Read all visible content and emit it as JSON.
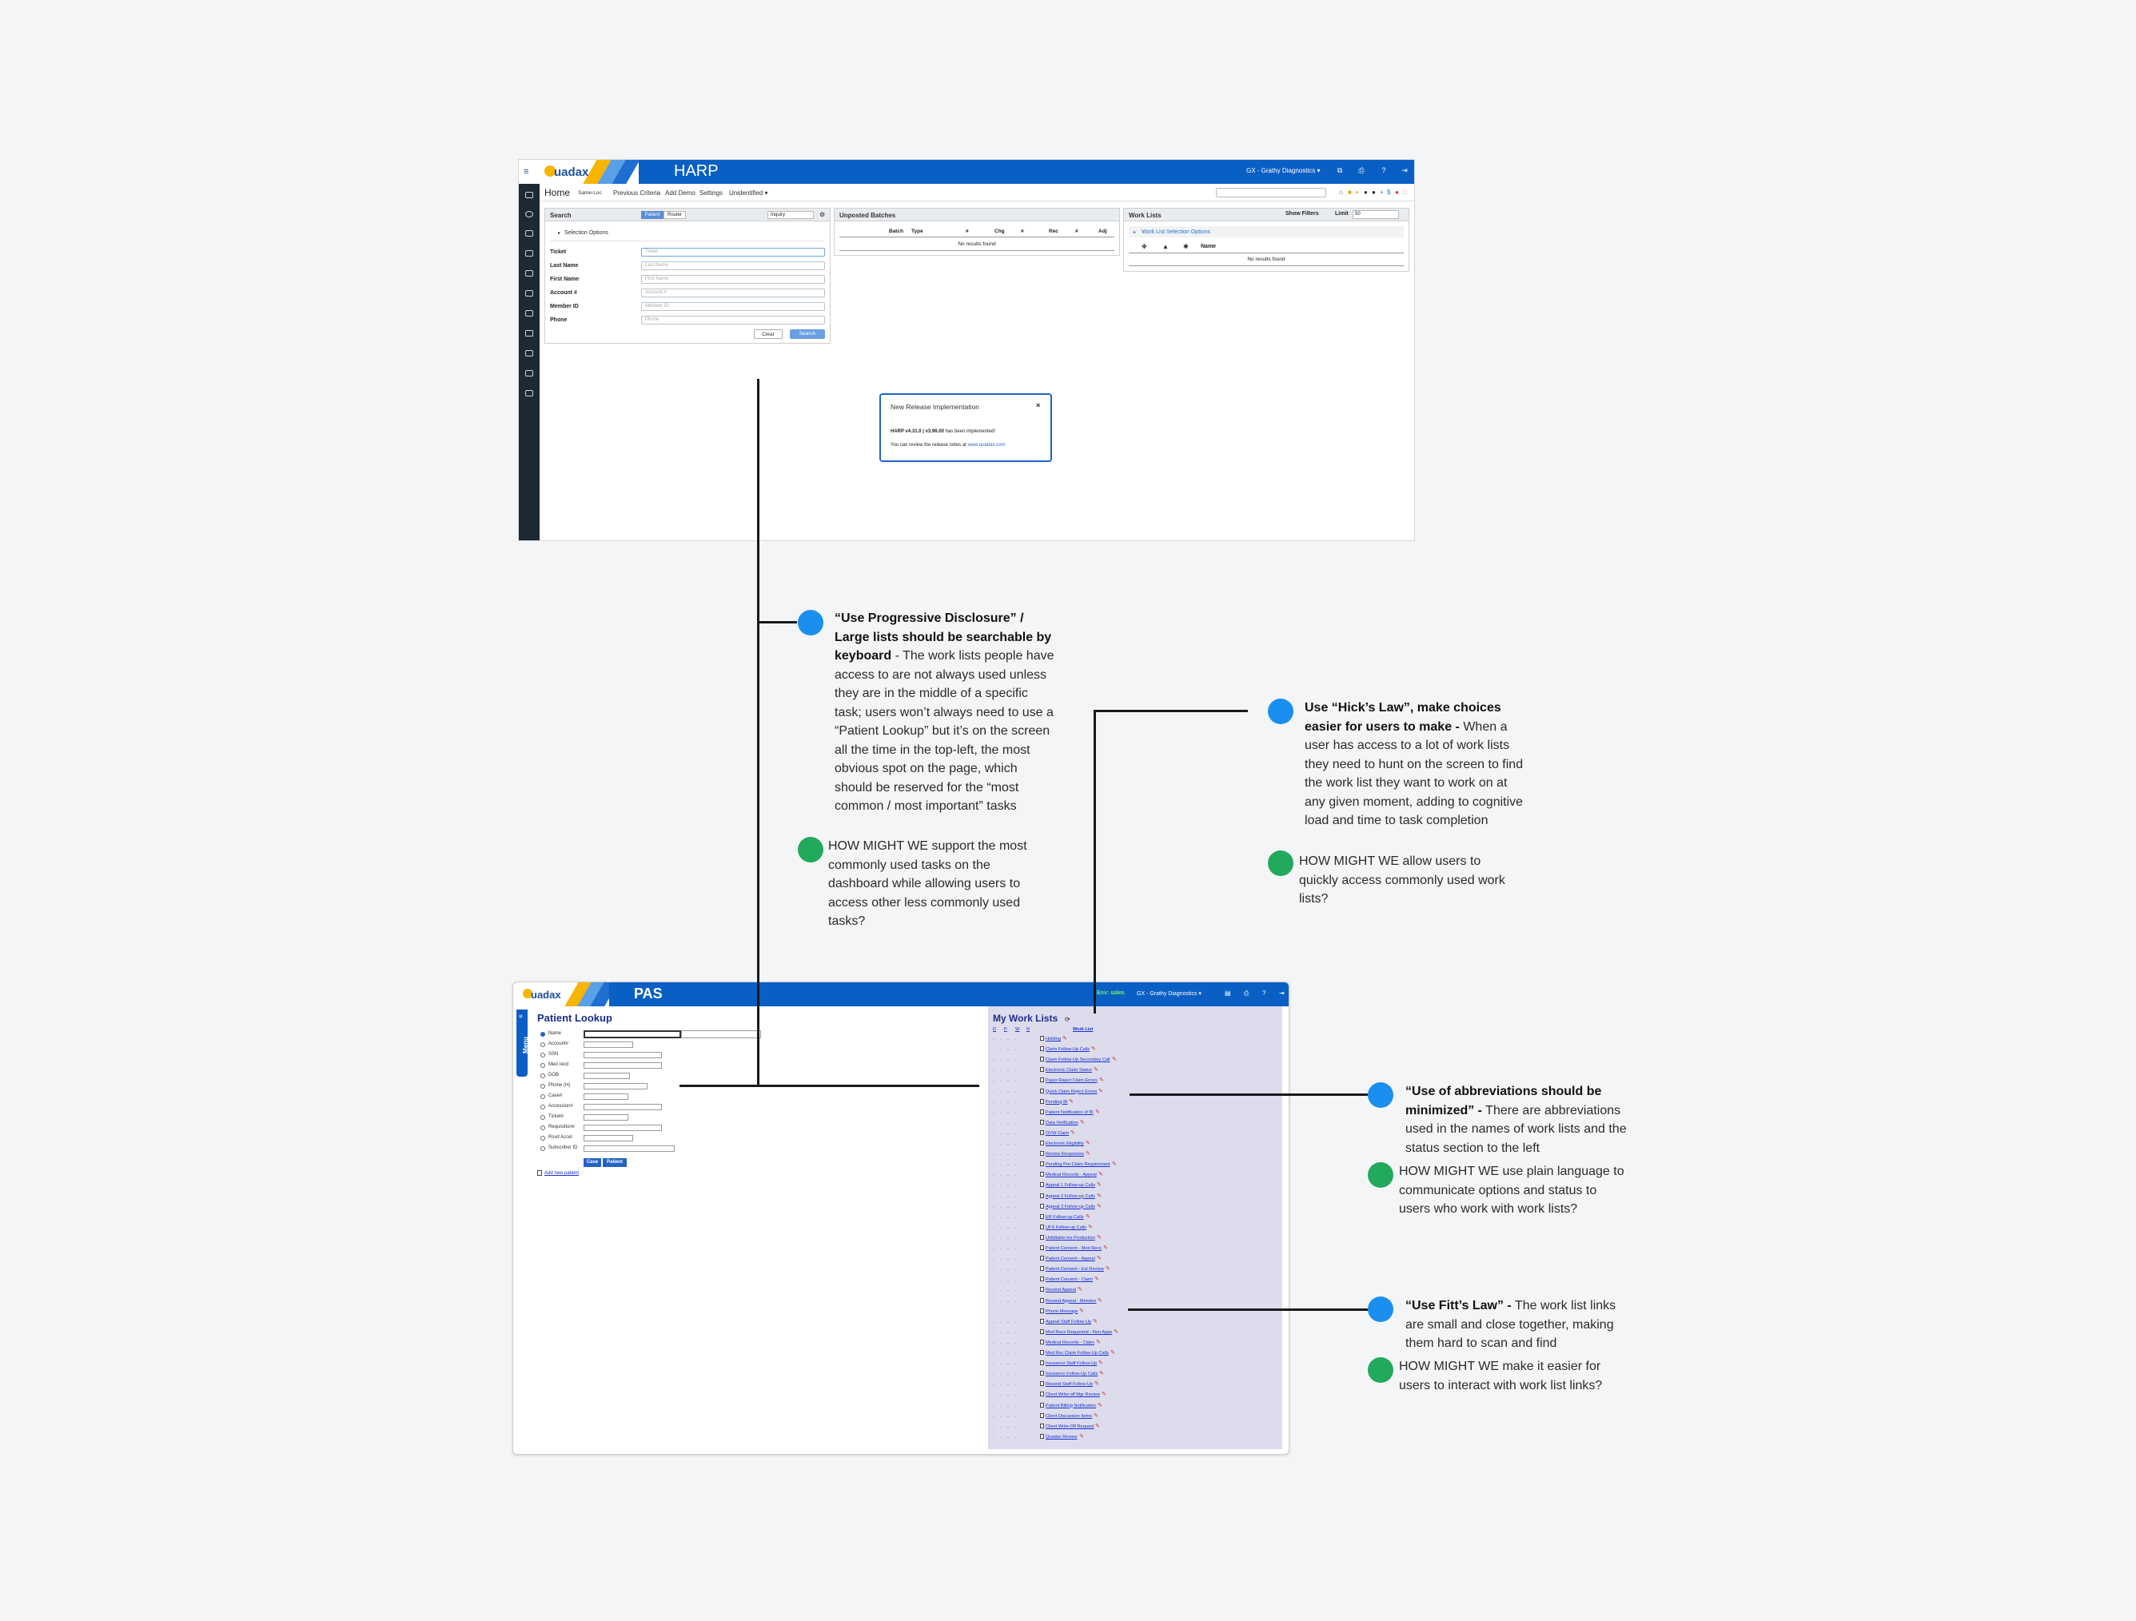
{
  "harp": {
    "logo_text": "uadax",
    "app_title": "HARP",
    "client": "GX - Grathy Diagnostics ▾",
    "nav": {
      "home": "Home",
      "items": [
        "Same-Loc",
        "Previous Criteria",
        "Add Demo",
        "Settings",
        "Unidentified ▾"
      ]
    },
    "search_panel": {
      "title": "Search",
      "toggle": [
        "Patient",
        "Router"
      ],
      "mode_select": "Inquiry",
      "selection_options": "Selection Options",
      "fields": [
        {
          "label": "Ticket",
          "placeholder": "Ticket"
        },
        {
          "label": "Last Name",
          "placeholder": "Last Name"
        },
        {
          "label": "First Name",
          "placeholder": "First Name"
        },
        {
          "label": "Account #",
          "placeholder": "Account #"
        },
        {
          "label": "Member ID",
          "placeholder": "Member ID"
        },
        {
          "label": "Phone",
          "placeholder": "Phone"
        }
      ],
      "clear": "Clear",
      "search": "Search"
    },
    "unposted": {
      "title": "Unposted Batches",
      "columns": [
        "Batch",
        "Type",
        "#",
        "Chg",
        "#",
        "Rec",
        "#",
        "Adj"
      ],
      "empty": "No results found"
    },
    "worklists": {
      "title": "Work Lists",
      "show_filters": "Show Filters",
      "limit_label": "Limit",
      "limit_value": "50",
      "selection_options": "Work List Selection Options",
      "name_col": "Name",
      "empty": "No results found"
    },
    "modal": {
      "title": "New Release Implementation",
      "close": "×",
      "version": "HARP v4.31.0 | v3.96.00",
      "implemented": "has been implemented!",
      "notes_prefix": "You can review the release notes at",
      "notes_link": "www.quadax.com"
    }
  },
  "pas": {
    "logo_text": "uadax",
    "app_title": "PAS",
    "env": "Env: sales",
    "client": "GX - Grathy Diagnostics ▾",
    "menu": "Menu",
    "lookup_title": "Patient Lookup",
    "lookup_fields": [
      "Name",
      "Account#",
      "SSN",
      "Med recd",
      "DOB",
      "Phone (H)",
      "Case#",
      "Accession#",
      "Ticket#",
      "Requisition#",
      "Rsvd Accel",
      "Subscriber ID"
    ],
    "btn_case": "Case",
    "btn_patient": "Patient",
    "add_patient": "Add new patient",
    "worklist_title": "My Work Lists",
    "worklist_headers": [
      "D",
      "P",
      "W",
      "N",
      "Work List"
    ],
    "work_lists": [
      "Holding",
      "Claim Follow-Up Calls",
      "Claim Follow-Up Secondary Call",
      "Electronic Claim Status",
      "Payer Reject Claim Errors",
      "Quick Claim Reject Errors",
      "Pending BI",
      "Patient Notification of BI",
      "Data Verification",
      "OVW Claim",
      "Electronic Eligibility",
      "Review Responses",
      "Pending Pre-Claim Requirement",
      "Medical Records - Appeal",
      "Appeal 1 Follow-up Calls",
      "Appeal 2 Follow-up Calls",
      "Appeal 3 Follow-up Calls",
      "ER Follow-up Calls",
      "UFS Follow-up Calls",
      "Unbillable Ins Production",
      "Patient Consent - Med Recs",
      "Patient Consent - Appeal",
      "Patient Consent - Ext Review",
      "Patient Consent - Claim",
      "Resend Appeal",
      "Resend Appeal - Member",
      "Phone Message",
      "Appeal Staff Follow-Up",
      "Med Recs Requested - Non Appe",
      "Medical Records - Claim",
      "Med Rec Claim Follow-Up Calls",
      "Insurance Staff Follow-Up",
      "Insurance Follow-Up Calls",
      "Resend Staff Follow-Up",
      "Client Write-off Mgr Review",
      "Patient Billing Notification",
      "Client Discussion Items",
      "Client Write-Off Request",
      "Quadax Review"
    ]
  },
  "annotations": [
    {
      "heading": "“Use Progressive Disclosure” / Large lists should be searchable by keyboard",
      "body": " - The work lists people have access to are not always used unless they are in the middle of a specific task; users won’t always need to use a “Patient Lookup” but it’s on the screen all the time in the top-left, the most obvious spot on the page, which should be reserved for the “most common / most important” tasks",
      "hmw": "HOW MIGHT WE support the most commonly used tasks on the dashboard while allowing users to access other less commonly used tasks?"
    },
    {
      "heading": "Use “Hick’s Law”, make choices easier for users to make -",
      "body": " When a user has access to a lot of work lists they need to hunt on the screen to find the work list they want to work on at any given moment, adding to cognitive load and time to task completion",
      "hmw": "HOW MIGHT WE allow users to quickly access commonly used work lists?"
    },
    {
      "heading": "“Use of abbreviations should be minimized” -",
      "body": " There are abbreviations used in the names of work lists and the status section to the left",
      "hmw": "HOW MIGHT WE use plain language to communicate options and status to users who work with work lists?"
    },
    {
      "heading": "“Use Fitt’s Law” -",
      "body": " The work list links are small and close together, making them hard to scan and find",
      "hmw": "HOW MIGHT WE make it easier for users to interact with work list links?"
    }
  ],
  "colors": {
    "brand_blue": "#0a5fc4",
    "note_blue": "#1a8ff0",
    "note_green": "#21a95c",
    "sidebar": "#1d2a33",
    "worklist_bg": "#dcdcec"
  }
}
